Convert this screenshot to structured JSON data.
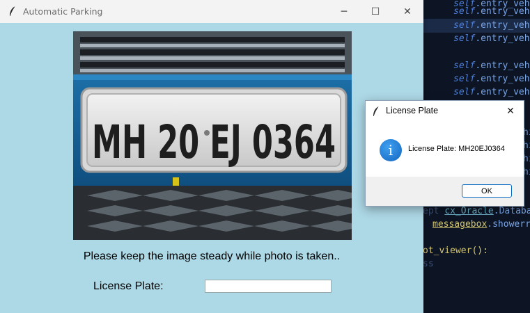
{
  "main_window": {
    "title": "Automatic Parking",
    "controls": {
      "minimize": "─",
      "maximize": "☐",
      "close": "✕"
    },
    "photo": {
      "plate_text": "MH 20 EJ 0364"
    },
    "caption": "Please keep the image steady while photo is taken..",
    "license_plate_label": "License Plate:",
    "license_plate_value": ""
  },
  "dialog": {
    "title": "License Plate",
    "close": "✕",
    "message": "License Plate: MH20EJ0364",
    "ok_label": "OK",
    "icon": "info-icon"
  },
  "editor": {
    "lines": [
      {
        "self": "self",
        "rest": ".entry_vehi"
      },
      {
        "self": "self",
        "rest": ".entry_vehi"
      },
      {
        "self": "self",
        "rest": ".entry_vehi"
      },
      {
        "self": "self",
        "rest": ".entry_vehi"
      },
      {
        "self": "self",
        "rest": ".entry_vehi"
      },
      {
        "self": "self",
        "rest": ".entry_vehi"
      },
      {
        "self": "self",
        "rest": ".entry_vehi"
      }
    ],
    "right_fragments": [
      "hi",
      "hi",
      "hi",
      "hi",
      "hi"
    ],
    "except_kw": "ept",
    "except_cls": "cx_Oracle",
    "except_attr": ".Databa",
    "messagebox": "messagebox",
    "showerror": ".showerr",
    "viewer_call": "ot_viewer():",
    "pass_kw": "ss"
  },
  "colors": {
    "window_bg": "#add8e6",
    "dialog_accent": "#0067c0",
    "editor_bg": "#0d1525"
  }
}
